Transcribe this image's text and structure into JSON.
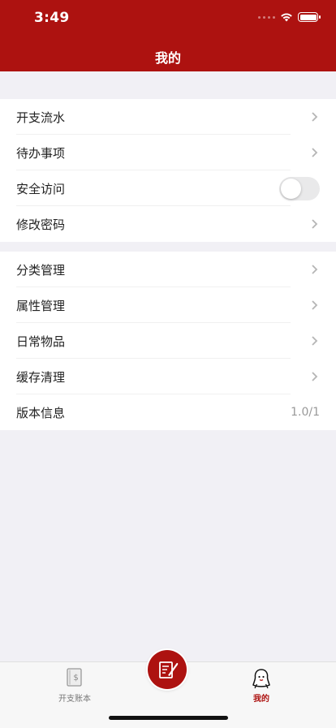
{
  "status_bar": {
    "time": "3:49"
  },
  "header": {
    "title": "我的"
  },
  "group1": [
    {
      "label": "开支流水",
      "accessory": "chevron"
    },
    {
      "label": "待办事项",
      "accessory": "chevron"
    },
    {
      "label": "安全访问",
      "accessory": "toggle",
      "toggle_on": false
    },
    {
      "label": "修改密码",
      "accessory": "chevron"
    }
  ],
  "group2": [
    {
      "label": "分类管理",
      "accessory": "chevron"
    },
    {
      "label": "属性管理",
      "accessory": "chevron"
    },
    {
      "label": "日常物品",
      "accessory": "chevron"
    },
    {
      "label": "缓存清理",
      "accessory": "chevron"
    },
    {
      "label": "版本信息",
      "accessory": "value",
      "value": "1.0/1"
    }
  ],
  "tabbar": {
    "tabs": [
      {
        "label": "开支账本",
        "icon": "ledger-book-icon",
        "active": false
      },
      {
        "label": "我的",
        "icon": "person-icon",
        "active": true
      }
    ],
    "center_button_icon": "edit-note-icon"
  },
  "colors": {
    "brand": "#ad1210",
    "background": "#f1f0f5"
  }
}
